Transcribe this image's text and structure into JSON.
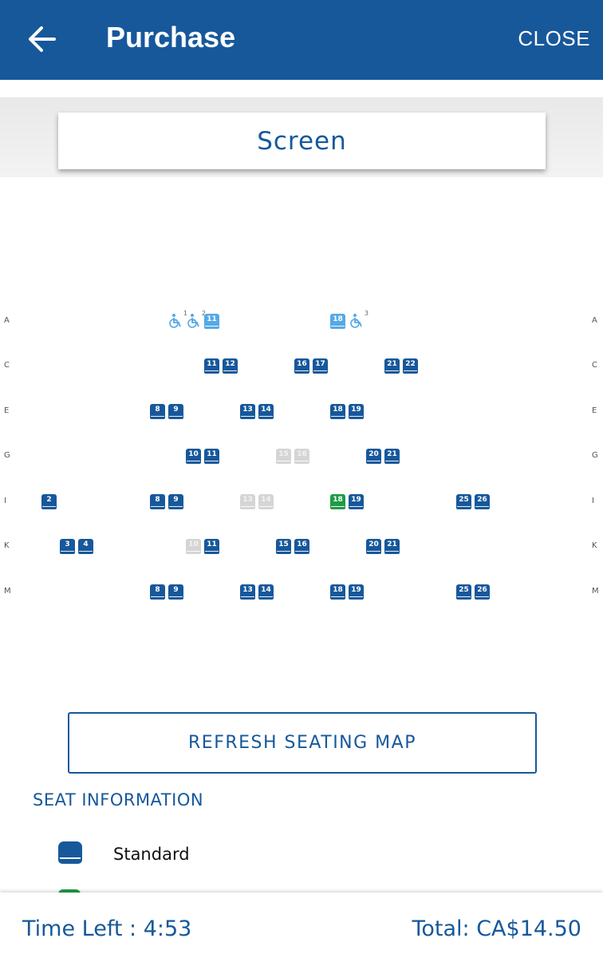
{
  "header": {
    "title": "Purchase",
    "close_label": "CLOSE",
    "back_icon": "arrow-left-icon",
    "background_color": "#17589b"
  },
  "screen": {
    "label": "Screen"
  },
  "seat_map": {
    "colors": {
      "available": "#17589b",
      "occupied": "#d5d5d5",
      "selected": "#1e9b45",
      "companion": "#56a9e6",
      "wheelchair": "#56a9e6"
    },
    "rows": [
      {
        "label": "A",
        "items": [
          {
            "type": "wheelchair",
            "number": "1"
          },
          {
            "type": "wheelchair",
            "number": "2"
          },
          {
            "type": "seat",
            "number": "11",
            "status": "companion"
          },
          {
            "type": "seat",
            "number": "18",
            "status": "companion"
          },
          {
            "type": "wheelchair",
            "number": "3"
          }
        ]
      },
      {
        "label": "C",
        "items": [
          {
            "type": "seat",
            "number": "11",
            "status": "available"
          },
          {
            "type": "seat",
            "number": "12",
            "status": "available"
          },
          {
            "type": "seat",
            "number": "16",
            "status": "available"
          },
          {
            "type": "seat",
            "number": "17",
            "status": "available"
          },
          {
            "type": "seat",
            "number": "21",
            "status": "available"
          },
          {
            "type": "seat",
            "number": "22",
            "status": "available"
          }
        ]
      },
      {
        "label": "E",
        "items": [
          {
            "type": "seat",
            "number": "8",
            "status": "available"
          },
          {
            "type": "seat",
            "number": "9",
            "status": "available"
          },
          {
            "type": "seat",
            "number": "13",
            "status": "available"
          },
          {
            "type": "seat",
            "number": "14",
            "status": "available"
          },
          {
            "type": "seat",
            "number": "18",
            "status": "available"
          },
          {
            "type": "seat",
            "number": "19",
            "status": "available"
          }
        ]
      },
      {
        "label": "G",
        "items": [
          {
            "type": "seat",
            "number": "10",
            "status": "available"
          },
          {
            "type": "seat",
            "number": "11",
            "status": "available"
          },
          {
            "type": "seat",
            "number": "15",
            "status": "occupied"
          },
          {
            "type": "seat",
            "number": "16",
            "status": "occupied"
          },
          {
            "type": "seat",
            "number": "20",
            "status": "available"
          },
          {
            "type": "seat",
            "number": "21",
            "status": "available"
          }
        ]
      },
      {
        "label": "I",
        "items": [
          {
            "type": "seat",
            "number": "2",
            "status": "available"
          },
          {
            "type": "seat",
            "number": "8",
            "status": "available"
          },
          {
            "type": "seat",
            "number": "9",
            "status": "available"
          },
          {
            "type": "seat",
            "number": "13",
            "status": "occupied"
          },
          {
            "type": "seat",
            "number": "14",
            "status": "occupied"
          },
          {
            "type": "seat",
            "number": "18",
            "status": "selected"
          },
          {
            "type": "seat",
            "number": "19",
            "status": "available"
          },
          {
            "type": "seat",
            "number": "25",
            "status": "available"
          },
          {
            "type": "seat",
            "number": "26",
            "status": "available"
          }
        ]
      },
      {
        "label": "K",
        "items": [
          {
            "type": "seat",
            "number": "3",
            "status": "available"
          },
          {
            "type": "seat",
            "number": "4",
            "status": "available"
          },
          {
            "type": "seat",
            "number": "10",
            "status": "occupied"
          },
          {
            "type": "seat",
            "number": "11",
            "status": "available"
          },
          {
            "type": "seat",
            "number": "15",
            "status": "available"
          },
          {
            "type": "seat",
            "number": "16",
            "status": "available"
          },
          {
            "type": "seat",
            "number": "20",
            "status": "available"
          },
          {
            "type": "seat",
            "number": "21",
            "status": "available"
          }
        ]
      },
      {
        "label": "M",
        "items": [
          {
            "type": "seat",
            "number": "8",
            "status": "available"
          },
          {
            "type": "seat",
            "number": "9",
            "status": "available"
          },
          {
            "type": "seat",
            "number": "13",
            "status": "available"
          },
          {
            "type": "seat",
            "number": "14",
            "status": "available"
          },
          {
            "type": "seat",
            "number": "18",
            "status": "available"
          },
          {
            "type": "seat",
            "number": "19",
            "status": "available"
          },
          {
            "type": "seat",
            "number": "25",
            "status": "available"
          },
          {
            "type": "seat",
            "number": "26",
            "status": "available"
          }
        ]
      }
    ]
  },
  "refresh_button": {
    "label": "REFRESH SEATING MAP"
  },
  "seat_info": {
    "title": "SEAT INFORMATION",
    "legend": [
      {
        "label": "Standard",
        "icon": "standard-seat-icon"
      }
    ]
  },
  "footer": {
    "time_left": "Time Left : 4:53",
    "total": "Total: CA$14.50"
  }
}
